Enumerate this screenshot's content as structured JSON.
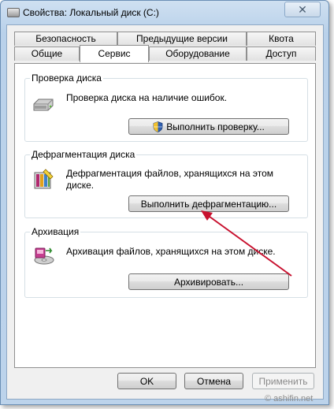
{
  "window": {
    "title": "Свойства: Локальный диск (C:)",
    "close_symbol": "✕"
  },
  "tabs": {
    "row_top": [
      {
        "label": "Безопасность"
      },
      {
        "label": "Предыдущие версии"
      },
      {
        "label": "Квота"
      }
    ],
    "row_bottom": [
      {
        "label": "Общие"
      },
      {
        "label": "Сервис",
        "active": true
      },
      {
        "label": "Оборудование"
      },
      {
        "label": "Доступ"
      }
    ]
  },
  "sections": {
    "check": {
      "title": "Проверка диска",
      "description": "Проверка диска на наличие ошибок.",
      "button": "Выполнить проверку...",
      "icon": "hard-drive-icon"
    },
    "defrag": {
      "title": "Дефрагментация диска",
      "description": "Дефрагментация файлов, хранящихся на этом диске.",
      "button": "Выполнить дефрагментацию...",
      "icon": "defrag-icon"
    },
    "backup": {
      "title": "Архивация",
      "description": "Архивация файлов, хранящихся на этом диске.",
      "button": "Архивировать...",
      "icon": "backup-icon"
    }
  },
  "footer": {
    "ok": "OK",
    "cancel": "Отмена",
    "apply": "Применить"
  },
  "watermark": "© ashifin.net",
  "colors": {
    "arrow": "#c8102e",
    "shield": "#2f5fb0"
  }
}
